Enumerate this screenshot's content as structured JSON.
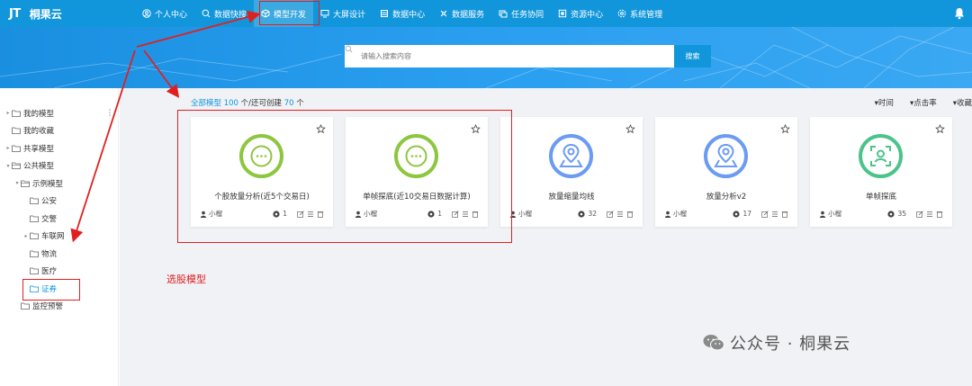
{
  "app": {
    "logo": "JT",
    "name": "桐果云"
  },
  "nav": [
    {
      "label": "个人中心",
      "icon": "user-icon",
      "active": false
    },
    {
      "label": "数据快搜",
      "icon": "search-icon",
      "active": false
    },
    {
      "label": "模型开发",
      "icon": "cube-icon",
      "active": true
    },
    {
      "label": "大屏设计",
      "icon": "monitor-icon",
      "active": false
    },
    {
      "label": "数据中心",
      "icon": "database-icon",
      "active": false
    },
    {
      "label": "数据服务",
      "icon": "service-icon",
      "active": false
    },
    {
      "label": "任务协同",
      "icon": "task-icon",
      "active": false
    },
    {
      "label": "资源中心",
      "icon": "resource-icon",
      "active": false
    },
    {
      "label": "系统管理",
      "icon": "gear-icon",
      "active": false
    }
  ],
  "search": {
    "placeholder": "请输入搜索内容",
    "button": "搜索"
  },
  "tree": [
    {
      "label": "我的模型",
      "level": 0,
      "arrow": "▸"
    },
    {
      "label": "我的收藏",
      "level": 0,
      "arrow": ""
    },
    {
      "label": "共享模型",
      "level": 0,
      "arrow": "▸"
    },
    {
      "label": "公共模型",
      "level": 0,
      "arrow": "▾"
    },
    {
      "label": "示例模型",
      "level": 1,
      "arrow": "▾"
    },
    {
      "label": "公安",
      "level": 2,
      "arrow": ""
    },
    {
      "label": "交警",
      "level": 2,
      "arrow": ""
    },
    {
      "label": "车联网",
      "level": 2,
      "arrow": "▸"
    },
    {
      "label": "物流",
      "level": 2,
      "arrow": ""
    },
    {
      "label": "医疗",
      "level": 2,
      "arrow": ""
    },
    {
      "label": "证券",
      "level": 2,
      "arrow": "",
      "selected": true
    },
    {
      "label": "监控预警",
      "level": 1,
      "arrow": ""
    }
  ],
  "summary": {
    "prefix": "全部模型",
    "total": "100",
    "mid": "个/还可创建",
    "remaining": "70",
    "suffix": "个"
  },
  "sorts": [
    "▾时间",
    "▾点击率",
    "▾收藏"
  ],
  "cards": [
    {
      "title": "个股放量分析(近5个交易日)",
      "author": "小榴",
      "count": "1",
      "icon": "more-dots-icon",
      "color": "#8dc63f"
    },
    {
      "title": "单帧探底(近10交易日数据计算)",
      "author": "小榴",
      "count": "1",
      "icon": "more-dots-icon",
      "color": "#8dc63f"
    },
    {
      "title": "放量缩量均线",
      "author": "小榴",
      "count": "32",
      "icon": "location-pin-icon",
      "color": "#6b9bf2"
    },
    {
      "title": "放量分析v2",
      "author": "小榴",
      "count": "17",
      "icon": "location-pin-icon",
      "color": "#6b9bf2"
    },
    {
      "title": "单帧探底",
      "author": "小榴",
      "count": "35",
      "icon": "face-scan-icon",
      "color": "#4cc38a"
    }
  ],
  "annotation": {
    "label": "选股模型",
    "color": "#e02020"
  },
  "watermark": "公众号 · 桐果云",
  "colors": {
    "primary": "#1296db",
    "background": "#f0f2f5"
  }
}
